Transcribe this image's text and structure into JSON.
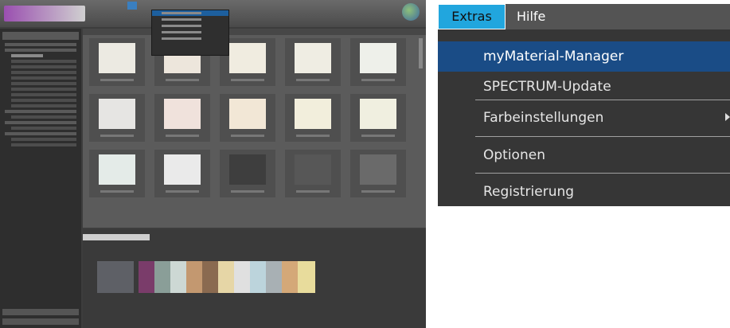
{
  "zoom_menu": {
    "menubar": {
      "extras_label": "Extras",
      "hilfe_label": "Hilfe"
    },
    "items": [
      {
        "label": "myMaterial-Manager",
        "highlighted": true
      },
      {
        "label": "SPECTRUM-Update"
      },
      {
        "label": "Farbeinstellungen",
        "has_submenu": true
      },
      {
        "label": "Optionen"
      },
      {
        "label": "Registrierung"
      }
    ]
  },
  "colors": {
    "menu_active": "#21a6de",
    "menu_highlight": "#1a4c86",
    "menu_background": "#363636",
    "app_background": "#3d3d3d"
  },
  "icons": [
    "globe-icon",
    "submenu-arrow-icon"
  ],
  "thumbnail_swatches": [
    "#eceae2",
    "#ede6dc",
    "#f0ece0",
    "#efede3",
    "#eef0ea",
    "#e6e5e3",
    "#f0e2dc",
    "#f2e7d6",
    "#f2eedc",
    "#f0efe0",
    "#e4ebe8",
    "#eaeaea",
    "#3e3e3e",
    "#575757",
    "#6a6a6a"
  ],
  "strip_colors": [
    "#5e6066",
    "#7a3c6a",
    "#8a9e98",
    "#cdd8d4",
    "#c39870",
    "#8a6a50",
    "#e6d6a6",
    "#e0e0e0",
    "#bcd4dc",
    "#a8b0b4",
    "#d4a878",
    "#e8dc9c"
  ]
}
